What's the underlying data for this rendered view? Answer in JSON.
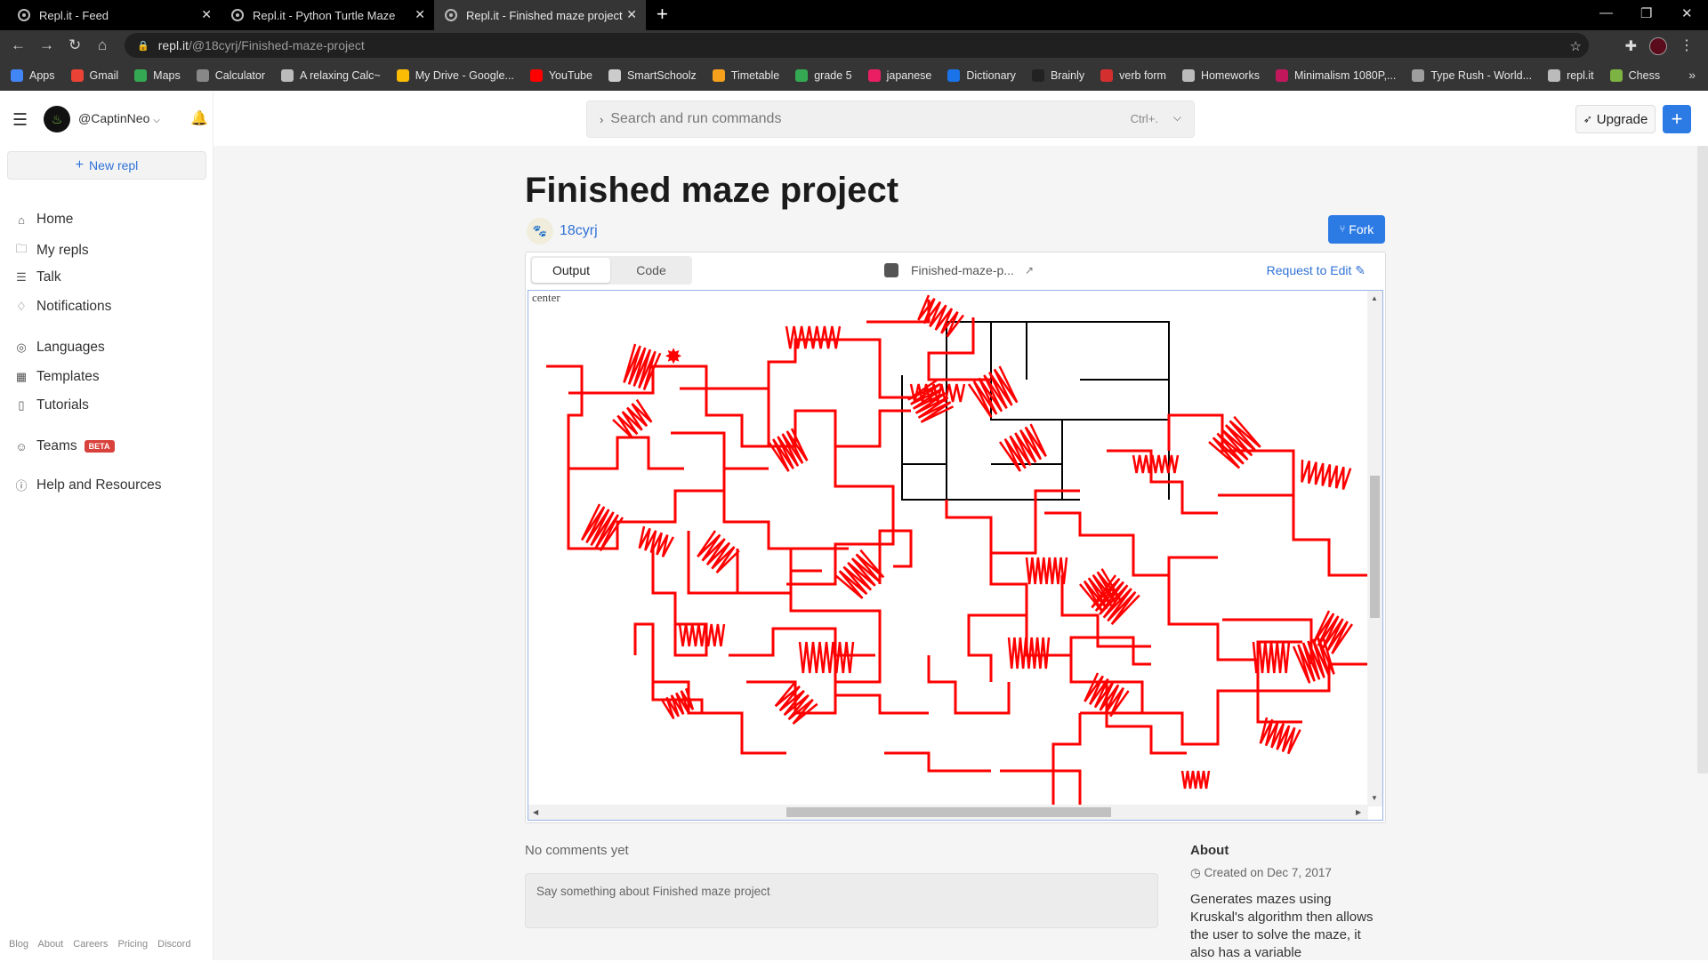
{
  "browser": {
    "tabs": [
      {
        "title": "Repl.it - Feed",
        "active": false
      },
      {
        "title": "Repl.it - Python Turtle Maze",
        "active": false
      },
      {
        "title": "Repl.it - Finished maze project",
        "active": true
      }
    ],
    "url_host": "repl.it",
    "url_path": "/@18cyrj/Finished-maze-project",
    "bookmarks": [
      "Apps",
      "Gmail",
      "Maps",
      "Calculator",
      "A relaxing Calc~",
      "My Drive - Google...",
      "YouTube",
      "SmartSchoolz",
      "Timetable",
      "grade 5",
      "japanese",
      "Dictionary",
      "Brainly",
      "verb form",
      "Homeworks",
      "Minimalism 1080P,...",
      "Type Rush - World...",
      "repl.it",
      "Chess"
    ]
  },
  "sidebar": {
    "username": "@CaptinNeo",
    "new_repl": "New repl",
    "items": [
      {
        "label": "Home",
        "icon": "home-icon"
      },
      {
        "label": "My repls",
        "icon": "folder-icon"
      },
      {
        "label": "Talk",
        "icon": "talk-icon"
      },
      {
        "label": "Notifications",
        "icon": "bell-icon"
      },
      {
        "label": "Languages",
        "icon": "globe-icon"
      },
      {
        "label": "Templates",
        "icon": "grid-icon"
      },
      {
        "label": "Tutorials",
        "icon": "book-icon"
      },
      {
        "label": "Teams",
        "icon": "people-icon"
      },
      {
        "label": "Help and Resources",
        "icon": "help-icon"
      }
    ],
    "beta_badge": "BETA",
    "footer": [
      "Blog",
      "About",
      "Careers",
      "Pricing",
      "Discord"
    ]
  },
  "header": {
    "search_placeholder": "Search and run commands",
    "search_shortcut": "Ctrl+.",
    "upgrade": "Upgrade"
  },
  "repl": {
    "title": "Finished maze project",
    "author": "18cyrj",
    "fork": "Fork",
    "tabs": [
      "Output",
      "Code"
    ],
    "active_tab": "Output",
    "file_name": "Finished-maze-p...",
    "request_edit": "Request to Edit",
    "canvas_label": "center"
  },
  "comments": {
    "empty_text": "No comments yet",
    "placeholder": "Say something about Finished maze project"
  },
  "about": {
    "heading": "About",
    "created": "Created on Dec 7, 2017",
    "description": "Generates mazes using Kruskal's algorithm then allows the user to solve the maze, it also has a variable"
  },
  "colors": {
    "accent": "#2c7be5",
    "maze_path": "#ff0000",
    "maze_wall": "#000000"
  }
}
